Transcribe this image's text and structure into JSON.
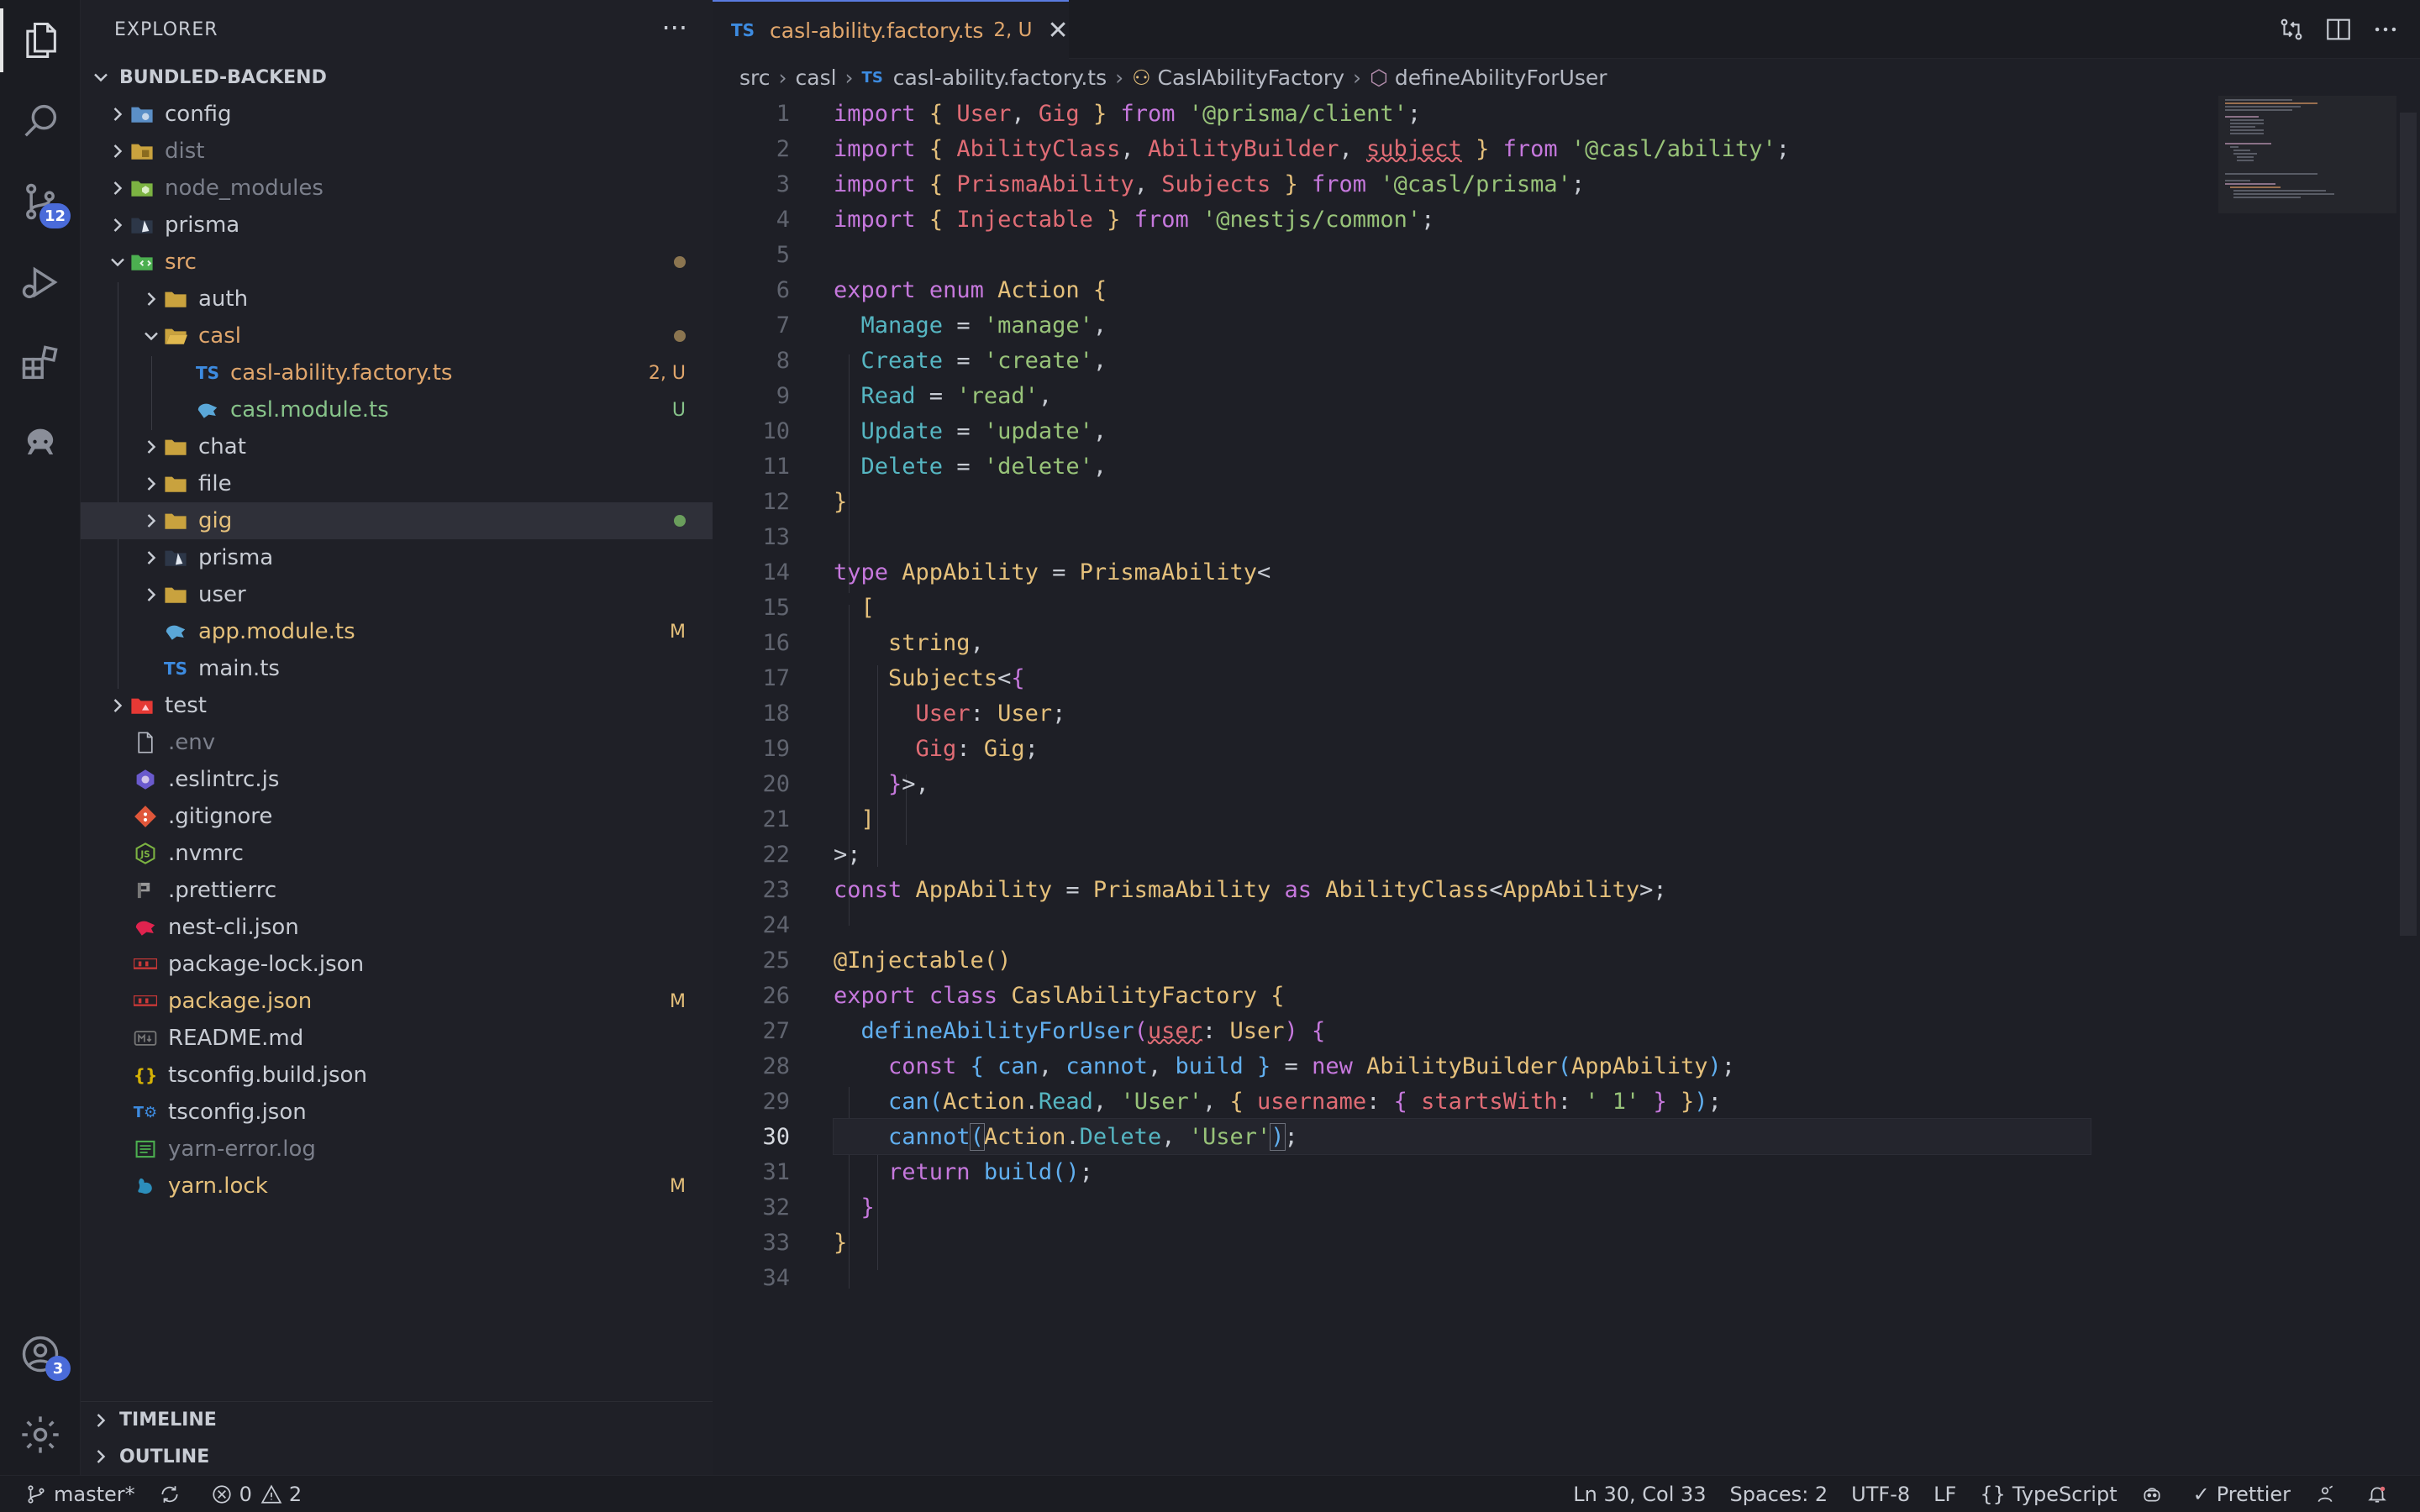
{
  "explorer": {
    "title": "EXPLORER",
    "more": "···",
    "root": "BUNDLED-BACKEND",
    "items": [
      {
        "name": "config",
        "kind": "folder"
      },
      {
        "name": "dist",
        "kind": "folder"
      },
      {
        "name": "node_modules",
        "kind": "folder"
      },
      {
        "name": "prisma",
        "kind": "folder"
      },
      {
        "name": "src",
        "kind": "folder"
      },
      {
        "name": "auth",
        "kind": "folder"
      },
      {
        "name": "casl",
        "kind": "folder"
      },
      {
        "name": "casl-ability.factory.ts",
        "kind": "file",
        "status": "2, U"
      },
      {
        "name": "casl.module.ts",
        "kind": "file",
        "status": "U"
      },
      {
        "name": "chat",
        "kind": "folder"
      },
      {
        "name": "file",
        "kind": "folder"
      },
      {
        "name": "gig",
        "kind": "folder"
      },
      {
        "name": "prisma",
        "kind": "folder"
      },
      {
        "name": "user",
        "kind": "folder"
      },
      {
        "name": "app.module.ts",
        "kind": "file",
        "status": "M"
      },
      {
        "name": "main.ts",
        "kind": "file"
      },
      {
        "name": "test",
        "kind": "folder"
      },
      {
        "name": ".env",
        "kind": "file"
      },
      {
        "name": ".eslintrc.js",
        "kind": "file"
      },
      {
        "name": ".gitignore",
        "kind": "file"
      },
      {
        "name": ".nvmrc",
        "kind": "file"
      },
      {
        "name": ".prettierrc",
        "kind": "file"
      },
      {
        "name": "nest-cli.json",
        "kind": "file"
      },
      {
        "name": "package-lock.json",
        "kind": "file"
      },
      {
        "name": "package.json",
        "kind": "file",
        "status": "M"
      },
      {
        "name": "README.md",
        "kind": "file"
      },
      {
        "name": "tsconfig.build.json",
        "kind": "file"
      },
      {
        "name": "tsconfig.json",
        "kind": "file"
      },
      {
        "name": "yarn-error.log",
        "kind": "file"
      },
      {
        "name": "yarn.lock",
        "kind": "file",
        "status": "M"
      }
    ],
    "timeline": "TIMELINE",
    "outline": "OUTLINE"
  },
  "activity": {
    "scm_badge": "12",
    "accounts_badge": "3"
  },
  "tab": {
    "lang": "TS",
    "name": "casl-ability.factory.ts",
    "status": "2, U",
    "close": "✕"
  },
  "breadcrumb": {
    "parts": [
      "src",
      "casl",
      "casl-ability.factory.ts",
      "CaslAbilityFactory",
      "defineAbilityForUser"
    ],
    "lang": "TS"
  },
  "editor": {
    "line_numbers": [
      "1",
      "2",
      "3",
      "4",
      "5",
      "6",
      "7",
      "8",
      "9",
      "10",
      "11",
      "12",
      "13",
      "14",
      "15",
      "16",
      "17",
      "18",
      "19",
      "20",
      "21",
      "22",
      "23",
      "24",
      "25",
      "26",
      "27",
      "28",
      "29",
      "30",
      "31",
      "32",
      "33",
      "34"
    ],
    "current_line": "30"
  },
  "statusbar": {
    "branch": "master*",
    "errors": "0",
    "warnings": "2",
    "position": "Ln 30, Col 33",
    "spaces": "Spaces: 2",
    "encoding": "UTF-8",
    "eol": "LF",
    "language": "TypeScript",
    "prettier": "Prettier"
  },
  "colors": {
    "accent": "#4a6bd9",
    "modified": "#e5c07b",
    "untracked": "#87c38a",
    "error": "#e0a66c"
  }
}
